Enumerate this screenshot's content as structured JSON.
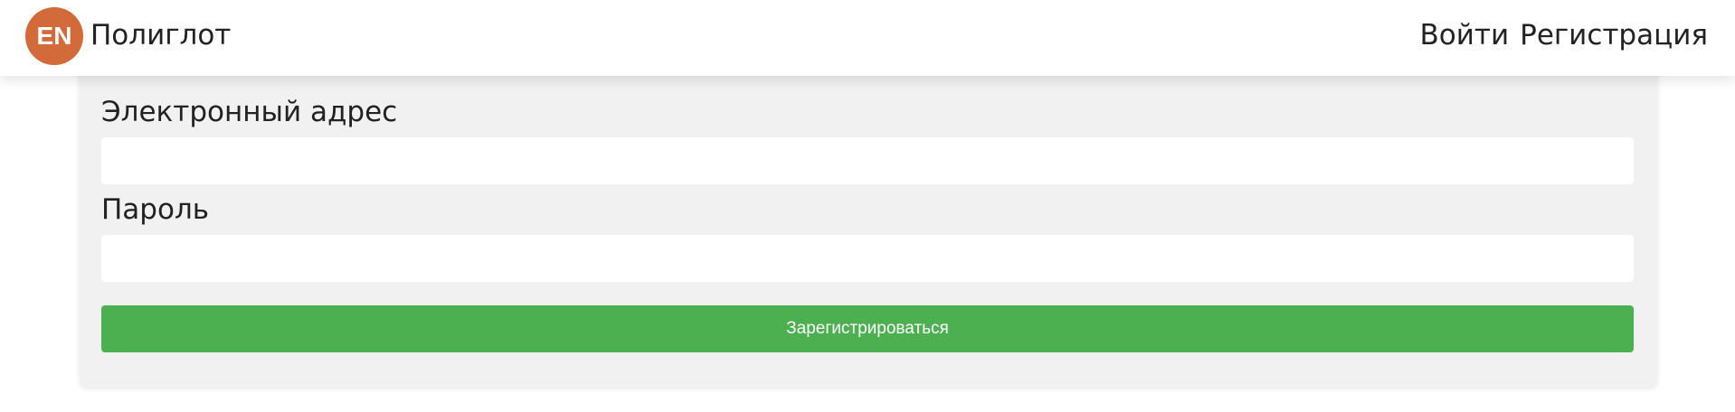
{
  "header": {
    "logo_text": "EN",
    "app_name": "Полиглот",
    "nav": {
      "login": "Войти",
      "register": "Регистрация"
    }
  },
  "form": {
    "email_label": "Электронный адрес",
    "email_value": "",
    "password_label": "Пароль",
    "password_value": "",
    "submit_label": "Зарегистрироваться"
  },
  "colors": {
    "logo_bg": "#d36a3a",
    "submit_bg": "#4caf50",
    "card_bg": "#f1f1f1"
  }
}
